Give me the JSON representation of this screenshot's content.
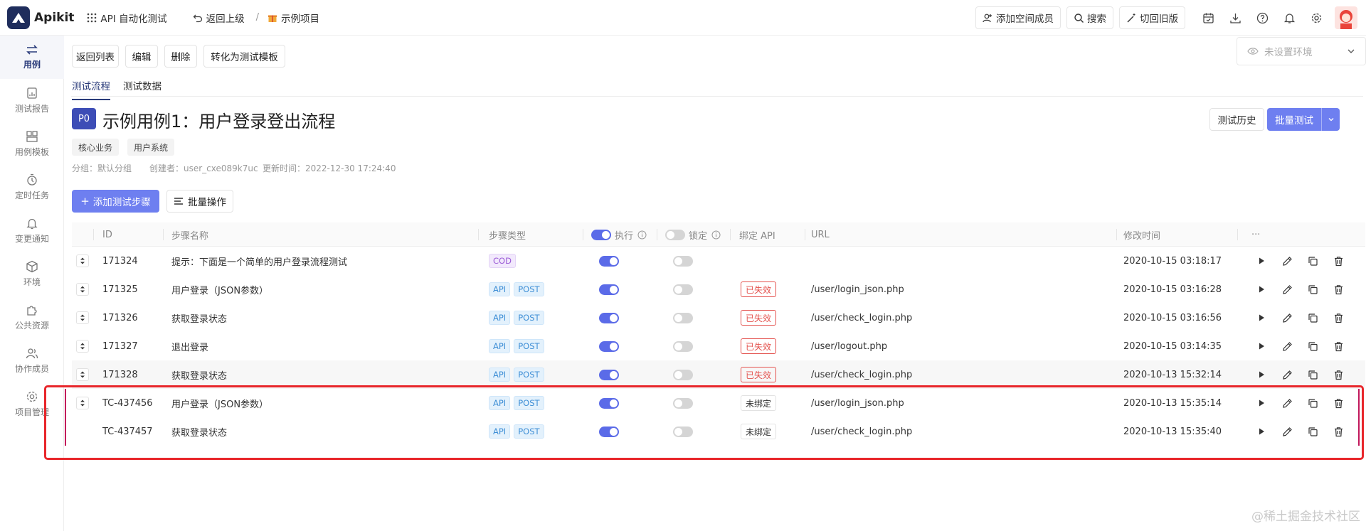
{
  "topbar": {
    "brand": "Apikit",
    "module": "API 自动化测试",
    "back": "返回上级",
    "breadcrumb_sep": "/",
    "project": "示例项目",
    "add_member": "添加空间成员",
    "search": "搜索",
    "switch_old": "切回旧版"
  },
  "sidebar": {
    "items": [
      {
        "label": "用例",
        "icon": "swap-icon"
      },
      {
        "label": "测试报告",
        "icon": "report-icon"
      },
      {
        "label": "用例模板",
        "icon": "template-icon"
      },
      {
        "label": "定时任务",
        "icon": "timer-icon"
      },
      {
        "label": "变更通知",
        "icon": "bell-icon"
      },
      {
        "label": "环境",
        "icon": "cube-icon"
      },
      {
        "label": "公共资源",
        "icon": "puzzle-icon"
      },
      {
        "label": "协作成员",
        "icon": "users-icon"
      },
      {
        "label": "项目管理",
        "icon": "gear-icon"
      }
    ]
  },
  "toolbar": {
    "back_list": "返回列表",
    "edit": "编辑",
    "delete": "删除",
    "convert": "转化为测试模板"
  },
  "env": {
    "placeholder": "未设置环境"
  },
  "tabs": [
    "测试流程",
    "测试数据"
  ],
  "case": {
    "priority": "P0",
    "title": "示例用例1：用户登录登出流程",
    "tags": [
      "核心业务",
      "用户系统"
    ],
    "group": "分组：默认分组",
    "creator": "创建者：user_cxe089k7uc",
    "updated": "更新时间：2022-12-30 17:24:40",
    "history_btn": "测试历史",
    "batch_test_btn": "批量测试"
  },
  "actions": {
    "add_step": "添加测试步骤",
    "batch_op": "批量操作"
  },
  "table": {
    "headers": {
      "id": "ID",
      "name": "步骤名称",
      "type": "步骤类型",
      "exec": "执行",
      "lock": "锁定",
      "bind": "绑定 API",
      "url": "URL",
      "mtime": "修改时间",
      "more": "···"
    },
    "rows": [
      {
        "id": "171324",
        "name": "提示：下面是一个简单的用户登录流程测试",
        "badges": [
          "COD"
        ],
        "exec": true,
        "lock": false,
        "bind": "",
        "url": "",
        "mtime": "2020-10-15 03:18:17",
        "drag": true
      },
      {
        "id": "171325",
        "name": "用户登录（JSON参数）",
        "badges": [
          "API",
          "POST"
        ],
        "exec": true,
        "lock": false,
        "bind": "已失效",
        "url": "/user/login_json.php",
        "mtime": "2020-10-15 03:16:28",
        "drag": true
      },
      {
        "id": "171326",
        "name": "获取登录状态",
        "badges": [
          "API",
          "POST"
        ],
        "exec": true,
        "lock": false,
        "bind": "已失效",
        "url": "/user/check_login.php",
        "mtime": "2020-10-15 03:16:56",
        "drag": true
      },
      {
        "id": "171327",
        "name": "退出登录",
        "badges": [
          "API",
          "POST"
        ],
        "exec": true,
        "lock": false,
        "bind": "已失效",
        "url": "/user/logout.php",
        "mtime": "2020-10-15 03:14:35",
        "drag": true
      },
      {
        "id": "171328",
        "name": "获取登录状态",
        "badges": [
          "API",
          "POST"
        ],
        "exec": true,
        "lock": false,
        "bind": "已失效",
        "url": "/user/check_login.php",
        "mtime": "2020-10-13 15:32:14",
        "drag": true
      },
      {
        "id": "TC-437456",
        "name": "用户登录（JSON参数）",
        "badges": [
          "API",
          "POST"
        ],
        "exec": true,
        "lock": false,
        "bind": "未绑定",
        "url": "/user/login_json.php",
        "mtime": "2020-10-13 15:35:14",
        "drag": true
      },
      {
        "id": "TC-437457",
        "name": "获取登录状态",
        "badges": [
          "API",
          "POST"
        ],
        "exec": true,
        "lock": false,
        "bind": "未绑定",
        "url": "/user/check_login.php",
        "mtime": "2020-10-13 15:35:40",
        "drag": false
      }
    ]
  },
  "watermark": "@稀土掘金技术社区",
  "colors": {
    "primary": "#6e7ff0",
    "brand_dark": "#2a3b7a",
    "danger": "#e4524e",
    "highlight_box": "#e8262b"
  }
}
